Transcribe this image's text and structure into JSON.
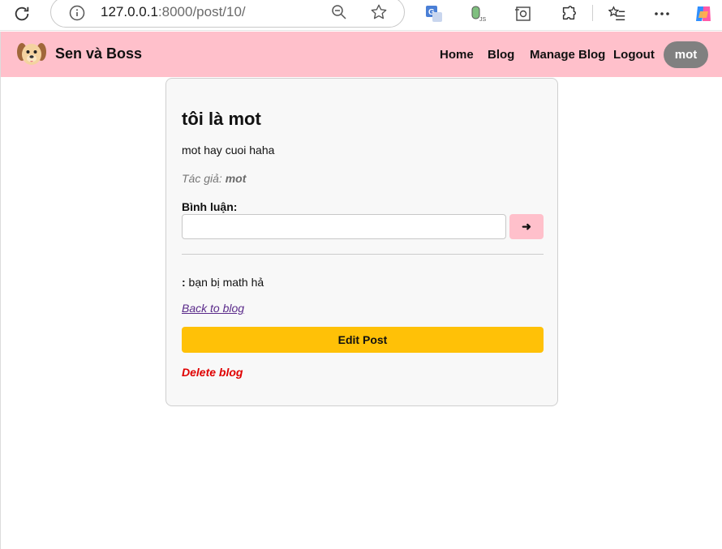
{
  "browser": {
    "url_host": "127.0.0.1",
    "url_rest": ":8000/post/10/"
  },
  "header": {
    "brand": "Sen và Boss",
    "nav": {
      "home": "Home",
      "blog": "Blog",
      "manage": "Manage Blog",
      "logout": "Logout"
    },
    "user": "mot"
  },
  "post": {
    "title": "tôi là mot",
    "content": "mot hay cuoi haha",
    "author_prefix": "Tác giả: ",
    "author_name": "mot",
    "comment_label": "Bình luận:",
    "comment_value": "",
    "send_label": "➜",
    "comments": [
      {
        "author": "",
        "sep": ":",
        "text": " bạn bị math hả"
      }
    ],
    "back_link": "Back to blog",
    "edit_label": "Edit Post",
    "delete_label": "Delete blog"
  },
  "colors": {
    "header_bg": "#ffc0cb",
    "edit_btn": "#ffc107",
    "delete": "#e00000",
    "user_pill": "#808080"
  }
}
